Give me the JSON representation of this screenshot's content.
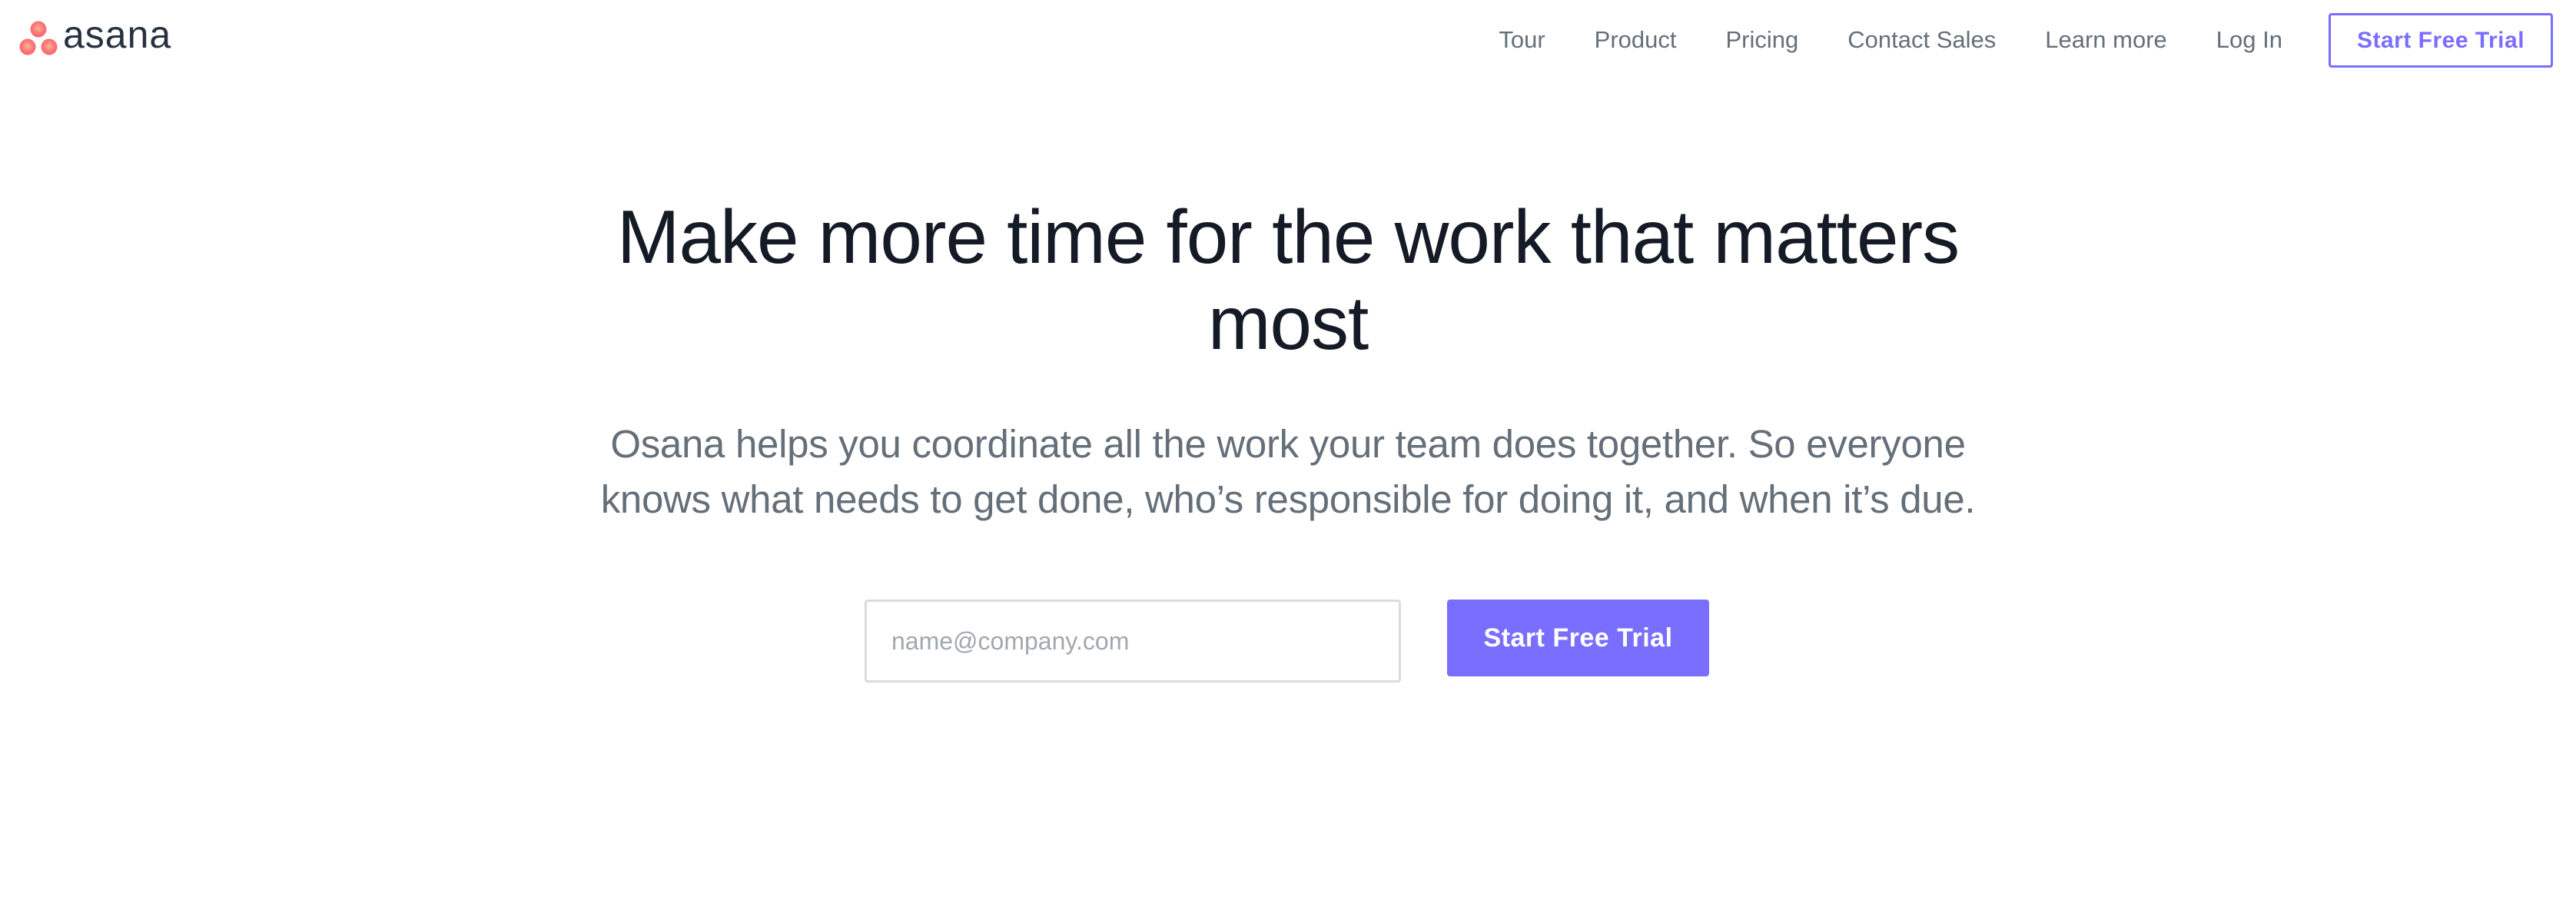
{
  "header": {
    "logo_text": "asana",
    "logo_colors": [
      "#f95d6a",
      "#fc636b",
      "#fa8a7a"
    ],
    "nav": [
      {
        "label": "Tour"
      },
      {
        "label": "Product"
      },
      {
        "label": "Pricing"
      },
      {
        "label": "Contact Sales"
      },
      {
        "label": "Learn more"
      },
      {
        "label": "Log In"
      }
    ],
    "cta_label": "Start Free Trial"
  },
  "hero": {
    "title": "Make more time for the work that matters most",
    "subtitle": "Osana helps you coordinate all the work your team does together. So everyone knows what needs to get done, who’s responsible for doing it, and when it’s due."
  },
  "signup": {
    "email_placeholder": "name@company.com",
    "email_value": "",
    "button_label": "Start Free Trial"
  },
  "colors": {
    "accent": "#796eff",
    "heading": "#151b26",
    "body_text": "#646f79",
    "input_border": "#d9dcdf"
  }
}
